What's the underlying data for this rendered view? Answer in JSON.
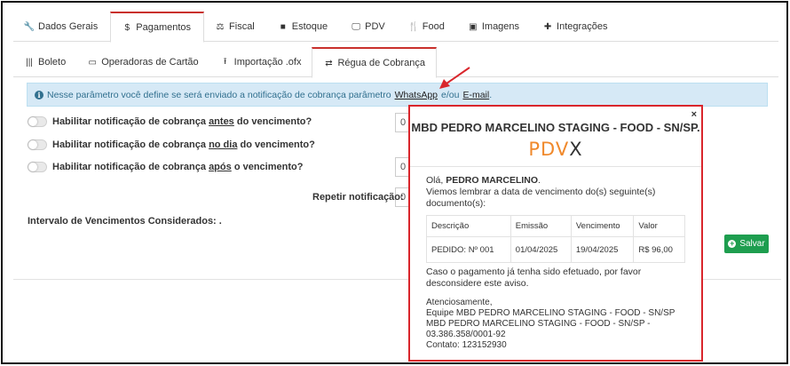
{
  "tabs": [
    {
      "label": "Dados Gerais",
      "icon": "wrench-icon"
    },
    {
      "label": "Pagamentos",
      "icon": "dollar-icon"
    },
    {
      "label": "Fiscal",
      "icon": "scale-icon"
    },
    {
      "label": "Estoque",
      "icon": "box-icon"
    },
    {
      "label": "PDV",
      "icon": "monitor-icon"
    },
    {
      "label": "Food",
      "icon": "utensils-icon"
    },
    {
      "label": "Imagens",
      "icon": "image-icon"
    },
    {
      "label": "Integrações",
      "icon": "puzzle-icon"
    }
  ],
  "subtabs": [
    {
      "label": "Boleto",
      "icon": "barcode-icon"
    },
    {
      "label": "Operadoras de Cartão",
      "icon": "credit-card-icon"
    },
    {
      "label": "Importação .ofx",
      "icon": "upload-icon"
    },
    {
      "label": "Régua de Cobrança",
      "icon": "exchange-icon"
    }
  ],
  "info": {
    "prefix": "Nesse parâmetro você define se será enviado a notificação de cobrança parâmetro",
    "whatsapp": "WhatsApp",
    "mid": "e/ou",
    "email": "E-mail",
    "suffix": "."
  },
  "toggles": [
    {
      "pre": "Habilitar notificação de cobrança",
      "emph": "antes",
      "post": "do vencimento?",
      "field_value": "0"
    },
    {
      "pre": "Habilitar notificação de cobrança",
      "emph": "no dia",
      "post": "do vencimento?",
      "field_value": ""
    },
    {
      "pre": "Habilitar notificação de cobrança",
      "emph": "após",
      "post": "o vencimento?",
      "field_value": "0"
    }
  ],
  "repeat": {
    "label": "Repetir notificação:",
    "value": "0"
  },
  "interval_label": "Intervalo de Vencimentos Considerados: .",
  "save_label": "Salvar",
  "modal": {
    "close": "×",
    "title": "MBD PEDRO MARCELINO STAGING - FOOD - SN/SP.",
    "logo_left": "PDV",
    "logo_right": "X",
    "greeting_prefix": "Olá, ",
    "greeting_name": "PEDRO MARCELINO",
    "greeting_suffix": ".",
    "intro": "Viemos lembrar a data de vencimento do(s) seguinte(s) documento(s):",
    "table": {
      "headers": [
        "Descrição",
        "Emissão",
        "Vencimento",
        "Valor"
      ],
      "rows": [
        [
          "PEDIDO: Nº 001",
          "01/04/2025",
          "19/04/2025",
          "R$ 96,00"
        ]
      ]
    },
    "paid_note": "Caso o pagamento já tenha sido efetuado, por favor desconsidere este aviso.",
    "signoff": "Atenciosamente,",
    "team": "Equipe MBD PEDRO MARCELINO STAGING - FOOD - SN/SP",
    "company_line": "MBD PEDRO MARCELINO STAGING - FOOD - SN/SP -",
    "cnpj": "03.386.358/0001-92",
    "contact": "Contato: 123152930"
  },
  "colors": {
    "accent": "#c9302c",
    "info_bg": "#d6e9f6",
    "save": "#1e9e4f",
    "highlight": "#d9262c"
  }
}
